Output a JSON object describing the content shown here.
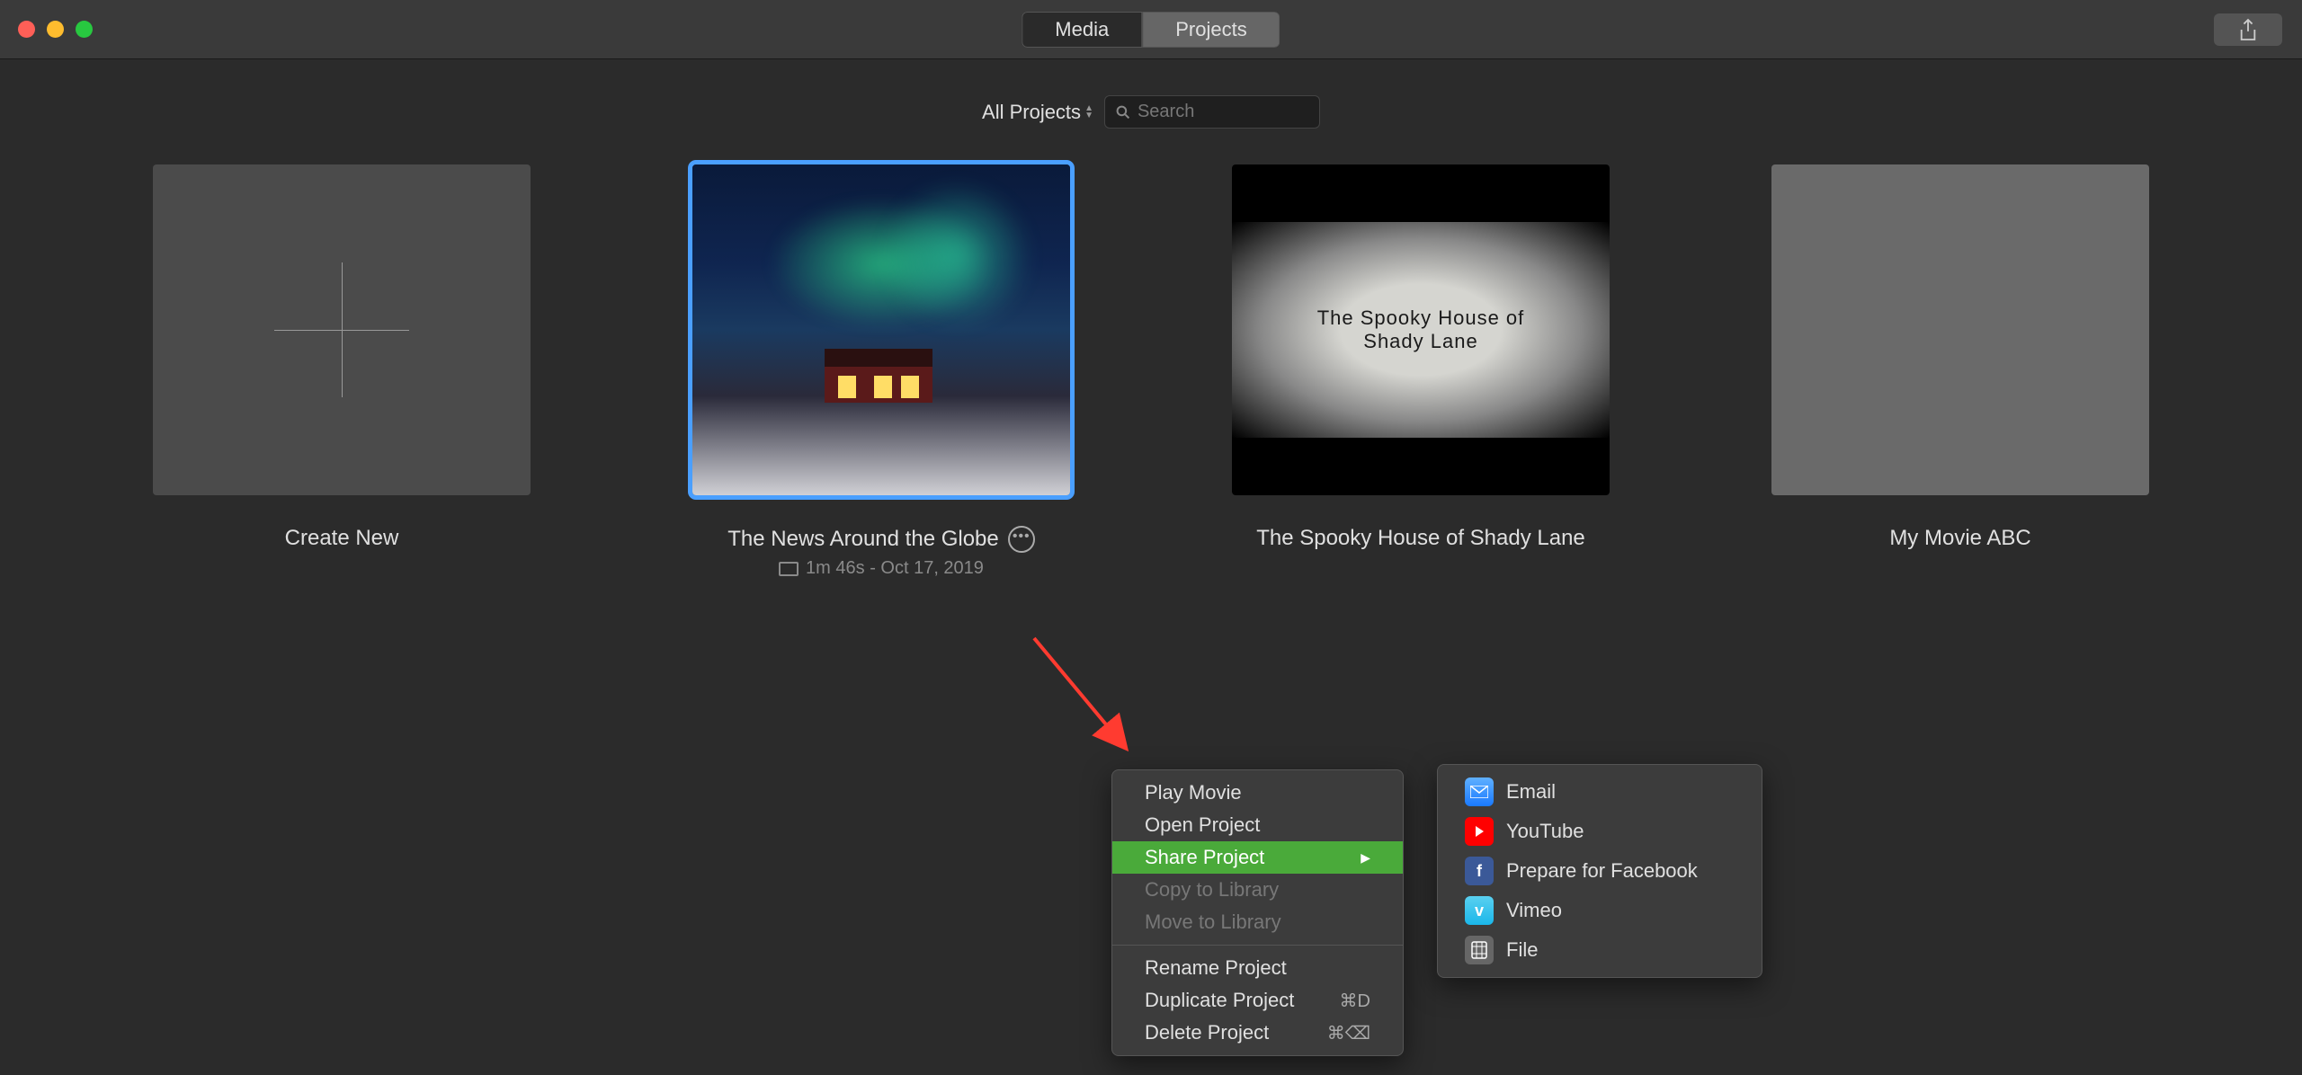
{
  "titlebar": {
    "tabs": {
      "media": "Media",
      "projects": "Projects"
    }
  },
  "filter": {
    "dropdown": "All Projects",
    "search_placeholder": "Search"
  },
  "projects": {
    "create_new": "Create New",
    "p1": {
      "title": "The News Around the Globe",
      "meta": "1m 46s - Oct 17, 2019"
    },
    "p2": {
      "title": "The Spooky House of Shady Lane",
      "thumb_line1": "The Spooky House of",
      "thumb_line2": "Shady Lane"
    },
    "p3": {
      "title": "My Movie ABC"
    }
  },
  "context_menu": {
    "play": "Play Movie",
    "open": "Open Project",
    "share": "Share Project",
    "copy": "Copy to Library",
    "move": "Move to Library",
    "rename": "Rename Project",
    "duplicate": "Duplicate Project",
    "duplicate_sc": "⌘D",
    "delete": "Delete Project",
    "delete_sc": "⌘⌫"
  },
  "share_submenu": {
    "email": "Email",
    "youtube": "YouTube",
    "facebook": "Prepare for Facebook",
    "vimeo": "Vimeo",
    "file": "File"
  }
}
